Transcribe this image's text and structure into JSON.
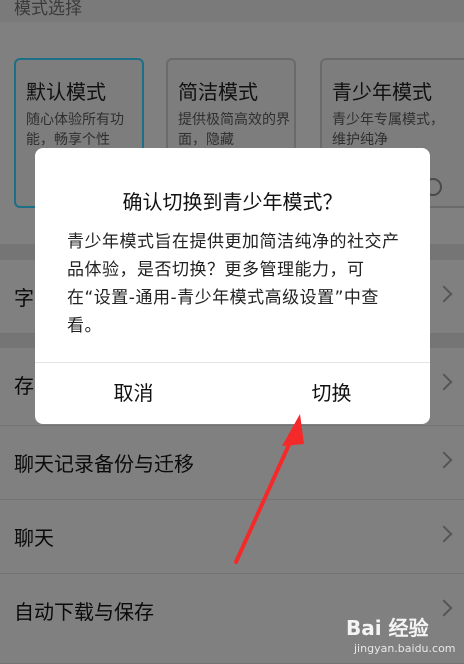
{
  "section": {
    "title": "模式选择"
  },
  "modes": [
    {
      "name": "默认模式",
      "desc": "随心体验所有功能，畅享个性",
      "selected": true
    },
    {
      "name": "简洁模式",
      "desc": "提供极简高效的界面，隐藏",
      "selected": false
    },
    {
      "name": "青少年模式",
      "desc": "青少年专属模式，维护纯净",
      "selected": false
    }
  ],
  "rows": [
    {
      "label": "字"
    },
    {
      "label": "存"
    },
    {
      "label": "聊天记录备份与迁移"
    },
    {
      "label": "聊天"
    },
    {
      "label": "自动下载与保存"
    }
  ],
  "dialog": {
    "title": "确认切换到青少年模式？",
    "message": "青少年模式旨在提供更加简洁纯净的社交产品体验，是否切换？更多管理能力，可在“设置-通用-青少年模式高级设置”中查看。",
    "cancel": "取消",
    "confirm": "切换"
  },
  "annotation": {
    "color": "#f42a2a"
  },
  "watermark": {
    "logo": "Bai 经验",
    "url": "jingyan.baidu.com"
  }
}
